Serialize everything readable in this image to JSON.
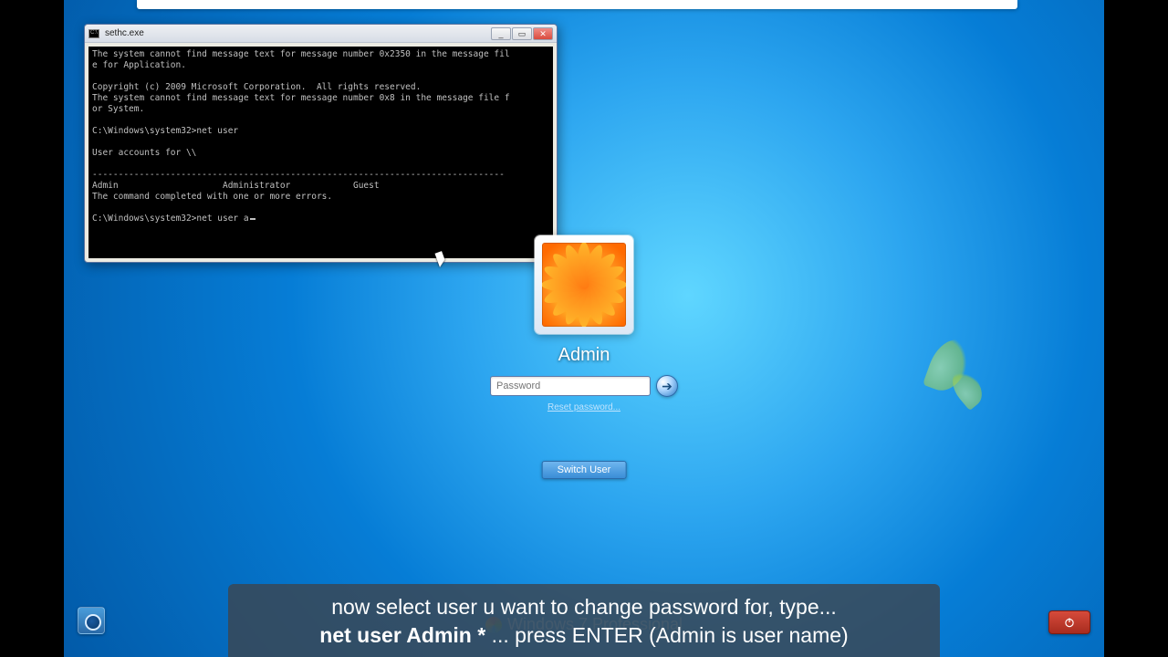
{
  "cmd": {
    "title": "sethc.exe",
    "lines": [
      "The system cannot find message text for message number 0x2350 in the message fil",
      "e for Application.",
      "",
      "Copyright (c) 2009 Microsoft Corporation.  All rights reserved.",
      "The system cannot find message text for message number 0x8 in the message file f",
      "or System.",
      "",
      "C:\\Windows\\system32>net user",
      "",
      "User accounts for \\\\",
      "",
      "-------------------------------------------------------------------------------",
      "Admin                    Administrator            Guest",
      "The command completed with one or more errors.",
      "",
      "C:\\Windows\\system32>net user a"
    ],
    "buttons": {
      "min": "_",
      "max": "▭",
      "close": "✕"
    }
  },
  "login": {
    "username": "Admin",
    "password_placeholder": "Password",
    "reset_link": "Reset password...",
    "switch_label": "Switch User",
    "go_glyph": "➔"
  },
  "branding": {
    "text": "Windows 7 Professional"
  },
  "caption": {
    "line1": "now select user u want to change password for, type...",
    "bold": "net user Admin *",
    "line2_rest": " ... press ENTER (Admin is user name)"
  }
}
